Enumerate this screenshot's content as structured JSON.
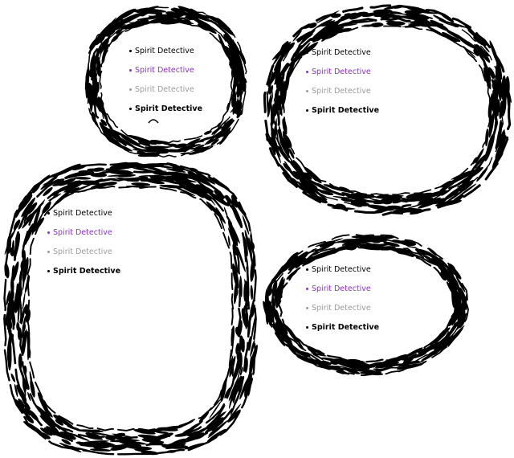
{
  "frames": [
    {
      "id": "small",
      "items": [
        {
          "label": "Spirit Detective",
          "state": "normal"
        },
        {
          "label": "Spirit Detective",
          "state": "hover"
        },
        {
          "label": "Spirit Detective",
          "state": "disabled"
        },
        {
          "label": "Spirit Detective",
          "state": "active"
        }
      ]
    },
    {
      "id": "wide",
      "items": [
        {
          "label": "Spirit Detective",
          "state": "normal"
        },
        {
          "label": "Spirit Detective",
          "state": "hover"
        },
        {
          "label": "Spirit Detective",
          "state": "disabled"
        },
        {
          "label": "Spirit Detective",
          "state": "active"
        }
      ]
    },
    {
      "id": "large",
      "items": [
        {
          "label": "Spirit Detective",
          "state": "normal"
        },
        {
          "label": "Spirit Detective",
          "state": "hover"
        },
        {
          "label": "Spirit Detective",
          "state": "disabled"
        },
        {
          "label": "Spirit Detective",
          "state": "active"
        }
      ]
    },
    {
      "id": "oval",
      "items": [
        {
          "label": "Spirit Detective",
          "state": "normal"
        },
        {
          "label": "Spirit Detective",
          "state": "hover"
        },
        {
          "label": "Spirit Detective",
          "state": "disabled"
        },
        {
          "label": "Spirit Detective",
          "state": "active"
        }
      ]
    }
  ],
  "colors": {
    "background": "#ffffff",
    "ink": "#000000",
    "hover": "#8a2be2",
    "disabled": "#9a9a9a"
  },
  "icons": {
    "bullet": "bullet-dot-icon",
    "caret": "caret-up-icon",
    "frame": "brush-ring-frame"
  }
}
